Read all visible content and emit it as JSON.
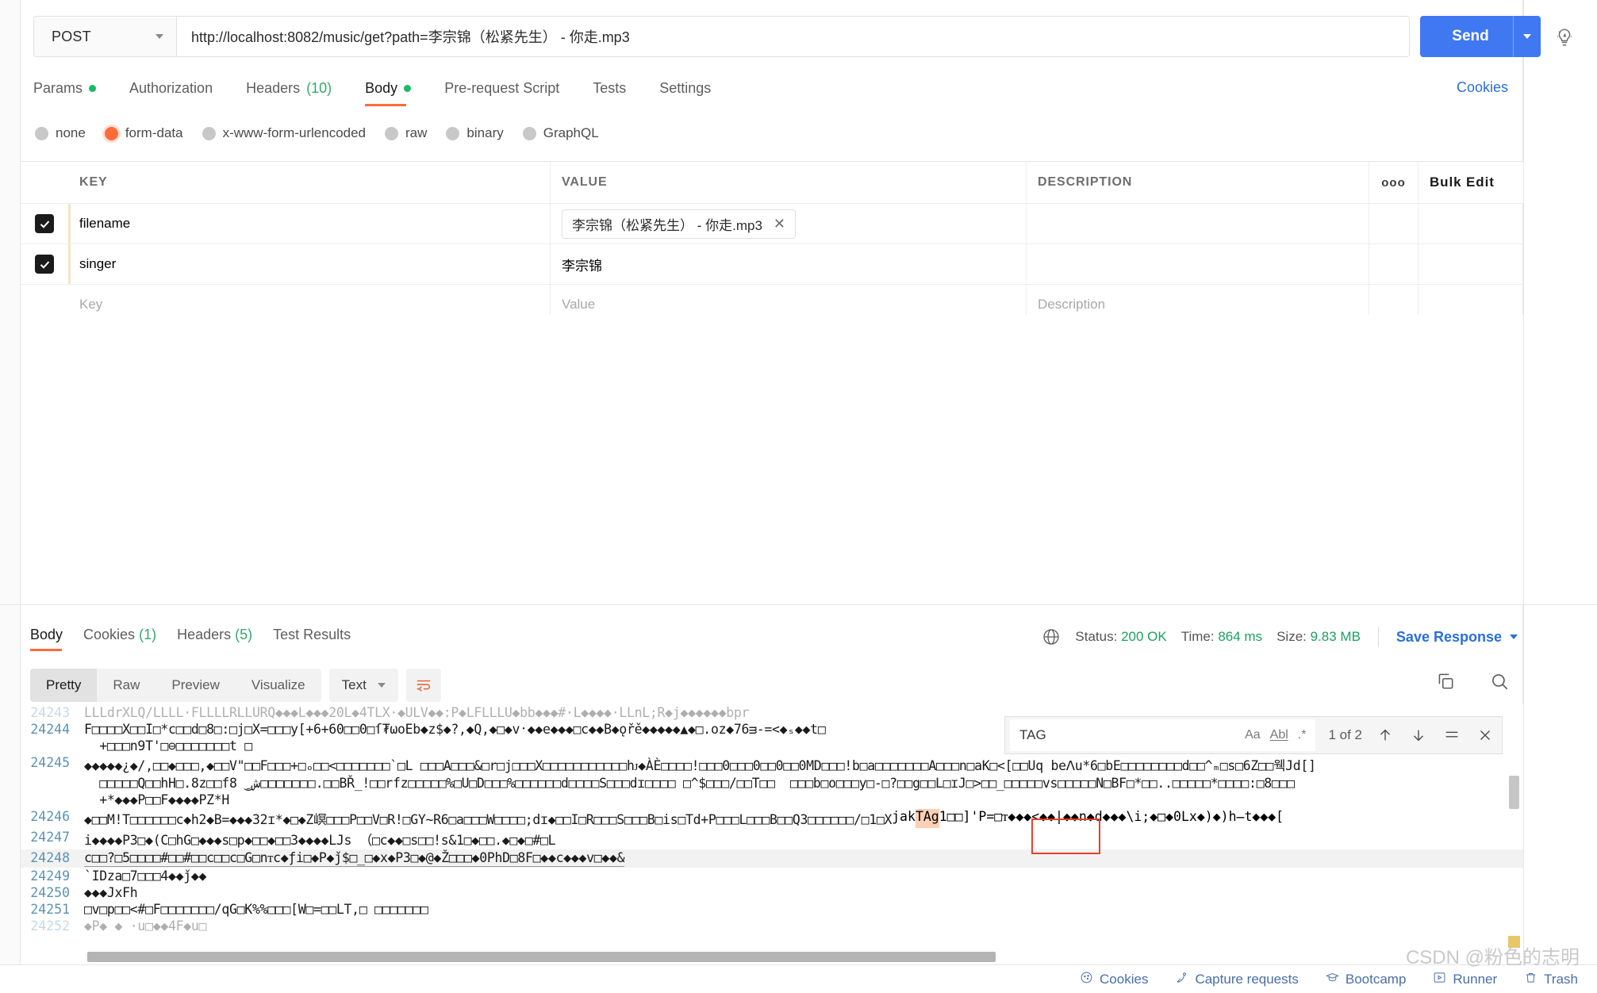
{
  "request": {
    "method": "POST",
    "url": "http://localhost:8082/music/get?path=李宗锦（松紧先生） - 你走.mp3",
    "send_label": "Send",
    "tabs": [
      {
        "label": "Params",
        "dot": true,
        "count": "",
        "active": false
      },
      {
        "label": "Authorization",
        "dot": false,
        "count": "",
        "active": false
      },
      {
        "label": "Headers",
        "dot": false,
        "count": "(10)",
        "active": false
      },
      {
        "label": "Body",
        "dot": true,
        "count": "",
        "active": true
      },
      {
        "label": "Pre-request Script",
        "dot": false,
        "count": "",
        "active": false
      },
      {
        "label": "Tests",
        "dot": false,
        "count": "",
        "active": false
      },
      {
        "label": "Settings",
        "dot": false,
        "count": "",
        "active": false
      }
    ],
    "cookies_link": "Cookies",
    "body_types": [
      {
        "label": "none",
        "selected": false
      },
      {
        "label": "form-data",
        "selected": true
      },
      {
        "label": "x-www-form-urlencoded",
        "selected": false
      },
      {
        "label": "raw",
        "selected": false
      },
      {
        "label": "binary",
        "selected": false
      },
      {
        "label": "GraphQL",
        "selected": false
      }
    ]
  },
  "params_table": {
    "headers": {
      "key": "KEY",
      "value": "VALUE",
      "description": "DESCRIPTION",
      "bulk_edit": "Bulk Edit",
      "dots": "ooo"
    },
    "rows": [
      {
        "checked": true,
        "key": "filename",
        "value": "李宗锦（松紧先生） - 你走.mp3",
        "is_file": true,
        "description": ""
      },
      {
        "checked": true,
        "key": "singer",
        "value": "李宗锦",
        "is_file": false,
        "description": ""
      },
      {
        "checked": false,
        "key": "Key",
        "value": "Value",
        "is_file": false,
        "description": "Description",
        "placeholder_row": true
      }
    ]
  },
  "response": {
    "tabs": [
      {
        "label": "Body",
        "count": "",
        "active": true
      },
      {
        "label": "Cookies",
        "count": "(1)",
        "active": false
      },
      {
        "label": "Headers",
        "count": "(5)",
        "active": false
      },
      {
        "label": "Test Results",
        "count": "",
        "active": false
      }
    ],
    "status_label": "Status:",
    "status_value": "200 OK",
    "time_label": "Time:",
    "time_value": "864 ms",
    "size_label": "Size:",
    "size_value": "9.83 MB",
    "save_response": "Save Response",
    "view_modes": [
      {
        "label": "Pretty",
        "active": true
      },
      {
        "label": "Raw",
        "active": false
      },
      {
        "label": "Preview",
        "active": false
      },
      {
        "label": "Visualize",
        "active": false
      }
    ],
    "format": "Text"
  },
  "find": {
    "query": "TAG",
    "opt_case": "Aa",
    "opt_word": "Abl",
    "opt_regex": ".*",
    "count": "1 of 2"
  },
  "code": {
    "lines": [
      {
        "num": "24243",
        "text": "LLLdrXLQ/LLLL·FLLLLRLLURQ◆◆◆L◆◆◆20L◆4TLX·◆ULV◆◆:P◆LFLLLU◆bb◆◆◆#·L◆◆◆◆·LLnL;R◆j◆◆◆◆◆◆bpr",
        "clipped": true
      },
      {
        "num": "24244",
        "text": "F□□□□X□□I□*c□□d□8□:□j□X=□□□y[+6+60□□0□ſ₮ωoEb◆z$◆?,◆Q,◆□◆v᛫◆◆e◆◆◆□c◆◆B◆ǫřě◆◆◆◆◆▲◆□.oz◆76ᴟ-=<◆ₛ◆◆t□",
        "clipped": false
      },
      {
        "num": "",
        "text": "  +□□□n9T'□⊖□□□□□□□t □",
        "clipped": false
      },
      {
        "num": "24245",
        "text": "◆◆◆◆◆¿◆/,□□◆□□□,◆□□V\"□□F□□□+□ₒ□□<□□□□□□□`□L □□□A□□□&□r□j□□□X□□□□□□□□□□□hᴊ◆ÀÈ□□□□!□□□0□□□0□□0□□0MD□□□!b□a□□□□□□□A□□□n□aK□<[□□Uq beꓥu*6□bE□□□□□□□□d□□^ₘ□s□6Z□□웩Jd[]",
        "clipped": false
      },
      {
        "num": "",
        "text": "  □□□□□Q□□hH□.8z□□f8 ‿ِش□□□□□□□.□□BŘ_!□□rfz□□□□□%□U□D□□□%□□□□□□d□□□□S□□□dɪ□□□□ □^$□□□/□□T□□  □□□b□o□□□y□-□?□□g□□L□ɪJ□>□□_□□□□□vs□□□□□N□BF□*□□..□□□□□*□□□□:□8□□□",
        "clipped": false
      },
      {
        "num": "",
        "text": "  +*◆◆◆P□□F◆◆◆◆PZ*H",
        "clipped": false
      },
      {
        "num": "24246",
        "text": "◆□□M!T□□□□□□c◆h2◆B=◆◆◆32ɪ*◆□◆Z㟰□□□P□□V□R!□GY~R6□a□□□W□□□□;dɪ◆□□I□R□□□S□□□B□is□Td+P□□□L□□□B□□Q3□□□□□□/□1□X",
        "clipped": false
      },
      {
        "num": "24247",
        "text": "i◆◆◆◆P3□◆(C□hG□◆◆◆s□p◆□□◆□□3◆◆◆◆LJs （□c◆◆□s□□!s&1□◆□□.◆□◆□#□L",
        "clipped": false
      },
      {
        "num": "24248",
        "text": "c□□?□5□□□□#□□#□□c□□c□G□nᴛc◆ƒi□◆P◆ǰ$□_□◆x◆P3□◆@◆Ž□□□◆0PhD□8F□◆◆c◆◆◆v□◆◆&",
        "clipped": false,
        "selected": true,
        "cursor": true
      },
      {
        "num": "24249",
        "text": "`IDza□7□□□4◆◆ǰ◆◆",
        "clipped": false
      },
      {
        "num": "24250",
        "text": "◆◆◆JxFh",
        "clipped": false
      },
      {
        "num": "24251",
        "text": "□v□p□□<#□F□□□□□□□/qG□K%%□□□[W□=□□LT,□ □□□□□□□",
        "clipped": false
      },
      {
        "num": "24252",
        "text": "◆P◆ ◆ ·u□◆◆4F◆u□",
        "clipped": true
      }
    ],
    "match_tail_prefix": "jak",
    "match_text": "TAg",
    "match_suffix": "1□□]'P=□ᴛ◆◆◆<◆◆|◆◆n◆d◆◆◆\\i;◆□◆0Lx◆)◆)h̶t◆◆◆["
  },
  "bottom_bar": {
    "items": [
      {
        "label": "Cookies",
        "icon": "cookie-icon"
      },
      {
        "label": "Capture requests",
        "icon": "satellite-icon"
      },
      {
        "label": "Bootcamp",
        "icon": "graduation-icon"
      },
      {
        "label": "Runner",
        "icon": "play-icon"
      },
      {
        "label": "Trash",
        "icon": "trash-icon"
      }
    ]
  },
  "watermark": "CSDN @粉色的志明",
  "colors": {
    "accent_orange": "#ff6c37",
    "send_blue": "#4078f2",
    "link_blue": "#2a6fdb",
    "status_green": "#1aa260",
    "dot_green": "#1bb965",
    "highlight_peach": "#fbd0b5",
    "match_border_red": "#e8402a"
  }
}
